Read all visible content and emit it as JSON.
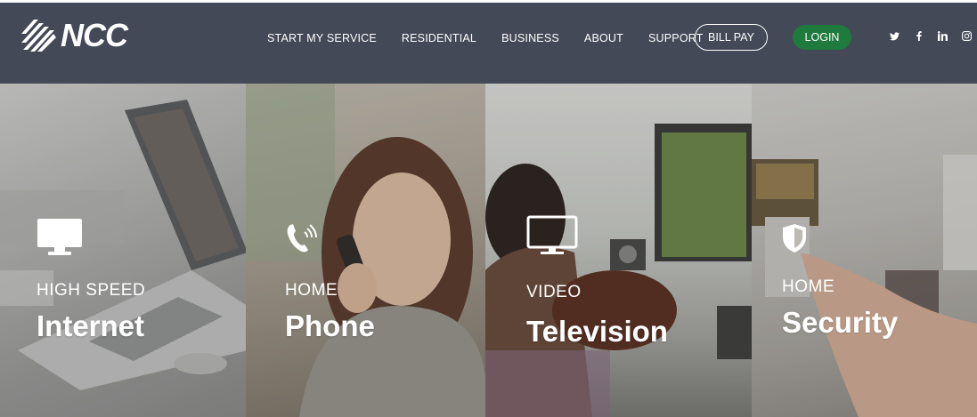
{
  "colors": {
    "header_bg": "#434957",
    "login_bg": "#1f7a3d",
    "text": "#ffffff"
  },
  "logo": {
    "text": "NCC",
    "icon": "ncc-striped-logo-icon"
  },
  "nav": {
    "items": [
      {
        "label": "START MY SERVICE"
      },
      {
        "label": "RESIDENTIAL"
      },
      {
        "label": "BUSINESS"
      },
      {
        "label": "ABOUT"
      },
      {
        "label": "SUPPORT"
      }
    ],
    "bill_pay_label": "BILL PAY",
    "login_label": "LOGIN"
  },
  "social": {
    "twitter": "twitter-icon",
    "facebook": "facebook-icon",
    "linkedin": "linkedin-icon",
    "instagram": "instagram-icon"
  },
  "panels": [
    {
      "kicker": "HIGH SPEED",
      "title": "Internet",
      "icon": "monitor-icon"
    },
    {
      "kicker": "HOME",
      "title": "Phone",
      "icon": "phone-icon"
    },
    {
      "kicker": "VIDEO",
      "title": "Television",
      "icon": "tv-icon"
    },
    {
      "kicker": "HOME",
      "title": "Security",
      "icon": "shield-icon"
    }
  ]
}
